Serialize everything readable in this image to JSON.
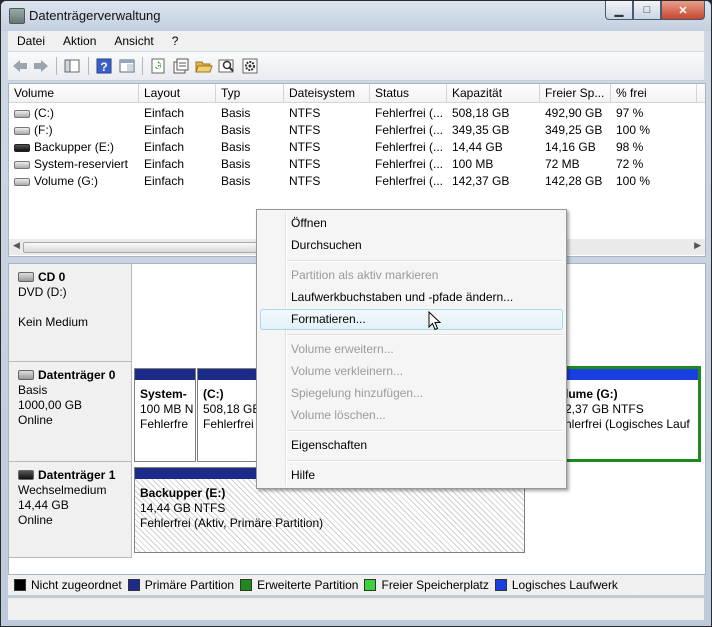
{
  "window": {
    "title": "Datenträgerverwaltung",
    "min_label": "▁",
    "max_label": "□",
    "close_label": "✕"
  },
  "menu": [
    "Datei",
    "Aktion",
    "Ansicht",
    "?"
  ],
  "columns": [
    "Volume",
    "Layout",
    "Typ",
    "Dateisystem",
    "Status",
    "Kapazität",
    "Freier Sp...",
    "% frei"
  ],
  "volumes": [
    {
      "name": "(C:)",
      "layout": "Einfach",
      "type": "Basis",
      "fs": "NTFS",
      "status": "Fehlerfrei (...",
      "capacity": "508,18 GB",
      "free": "492,90 GB",
      "pct": "97 %"
    },
    {
      "name": "(F:)",
      "layout": "Einfach",
      "type": "Basis",
      "fs": "NTFS",
      "status": "Fehlerfrei (...",
      "capacity": "349,35 GB",
      "free": "349,25 GB",
      "pct": "100 %"
    },
    {
      "name": "Backupper (E:)",
      "layout": "Einfach",
      "type": "Basis",
      "fs": "NTFS",
      "status": "Fehlerfrei (...",
      "capacity": "14,44 GB",
      "free": "14,16 GB",
      "pct": "98 %"
    },
    {
      "name": "System-reserviert",
      "layout": "Einfach",
      "type": "Basis",
      "fs": "NTFS",
      "status": "Fehlerfrei (...",
      "capacity": "100 MB",
      "free": "72 MB",
      "pct": "72 %"
    },
    {
      "name": "Volume (G:)",
      "layout": "Einfach",
      "type": "Basis",
      "fs": "NTFS",
      "status": "Fehlerfrei (...",
      "capacity": "142,37 GB",
      "free": "142,28 GB",
      "pct": "100 %"
    }
  ],
  "disks": [
    {
      "title": "CD 0",
      "line1": "DVD (D:)",
      "line2": "",
      "line3": "Kein Medium"
    },
    {
      "title": "Datenträger 0",
      "line1": "Basis",
      "line2": "1000,00 GB",
      "line3": "Online"
    },
    {
      "title": "Datenträger 1",
      "line1": "Wechselmedium",
      "line2": "14,44 GB",
      "line3": "Online"
    }
  ],
  "partitions": {
    "sysres": {
      "name": "System-",
      "size": "100 MB N",
      "status": "Fehlerfre"
    },
    "c": {
      "name": "(C:)",
      "size": "508,18 GB",
      "status": "Fehlerfrei"
    },
    "g": {
      "name": "lume  (G:)",
      "size": "2,37 GB NTFS",
      "status": "hlerfrei (Logisches Lauf"
    },
    "e": {
      "name": "Backupper  (E:)",
      "size": "14,44 GB NTFS",
      "status": "Fehlerfrei (Aktiv, Primäre Partition)"
    }
  },
  "legend": [
    {
      "label": "Nicht zugeordnet",
      "color": "#000000"
    },
    {
      "label": "Primäre Partition",
      "color": "#1b2b8a"
    },
    {
      "label": "Erweiterte Partition",
      "color": "#1e8a1e"
    },
    {
      "label": "Freier Speicherplatz",
      "color": "#3bd23b"
    },
    {
      "label": "Logisches Laufwerk",
      "color": "#1a3fe0"
    }
  ],
  "context_menu": [
    {
      "label": "Öffnen",
      "enabled": true
    },
    {
      "label": "Durchsuchen",
      "enabled": true
    },
    {
      "label": "Partition als aktiv markieren",
      "enabled": false
    },
    {
      "label": "Laufwerkbuchstaben und -pfade ändern...",
      "enabled": true
    },
    {
      "label": "Formatieren...",
      "enabled": true
    },
    {
      "label": "Volume erweitern...",
      "enabled": false
    },
    {
      "label": "Volume verkleinern...",
      "enabled": false
    },
    {
      "label": "Spiegelung hinzufügen...",
      "enabled": false
    },
    {
      "label": "Volume löschen...",
      "enabled": false
    },
    {
      "label": "Eigenschaften",
      "enabled": true
    },
    {
      "label": "Hilfe",
      "enabled": true
    }
  ]
}
